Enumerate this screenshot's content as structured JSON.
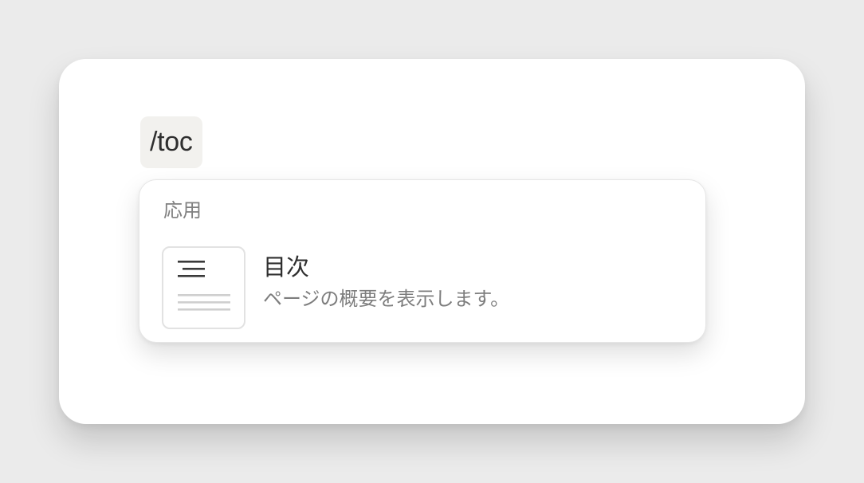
{
  "editor": {
    "command_text": "/toc"
  },
  "popup": {
    "section_label": "応用",
    "items": [
      {
        "icon": "table-of-contents-icon",
        "title": "目次",
        "description": "ページの概要を表示します。"
      }
    ]
  }
}
